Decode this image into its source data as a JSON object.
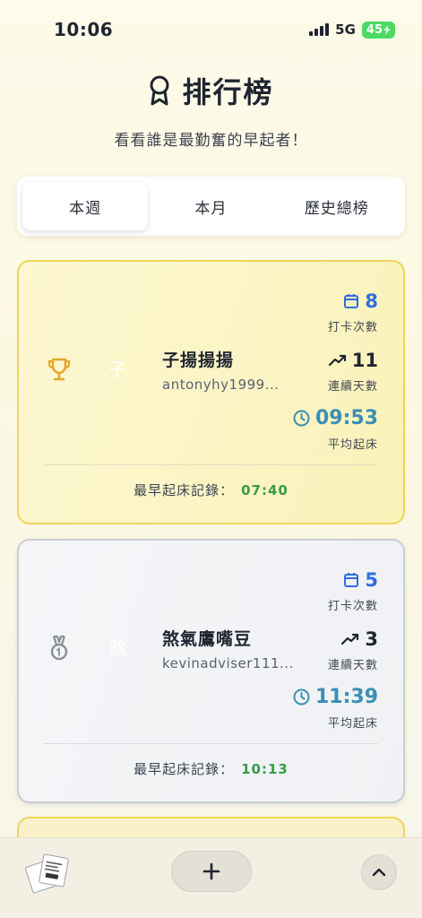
{
  "status_bar": {
    "time": "10:06",
    "network": "5G",
    "battery": "45"
  },
  "header": {
    "title": "排行榜",
    "subtitle": "看看誰是最勤奮的早起者！"
  },
  "tabs": [
    {
      "label": "本週",
      "active": true
    },
    {
      "label": "本月",
      "active": false
    },
    {
      "label": "歷史總榜",
      "active": false
    }
  ],
  "leaderboard": [
    {
      "rank_icon": "trophy-icon",
      "avatar_char": "子",
      "name": "子揚揚揚",
      "handle": "antonyhy1999...",
      "checkins": "8",
      "checkins_label": "打卡次數",
      "streak": "11",
      "streak_label": "連續天數",
      "avg_wake": "09:53",
      "avg_wake_label": "平均起床",
      "record_label": "最早起床記錄：",
      "record_time": "07:40"
    },
    {
      "rank_icon": "medal-icon",
      "avatar_char": "煞",
      "name": "煞氣鷹嘴豆",
      "handle": "kevinadviser111...",
      "checkins": "5",
      "checkins_label": "打卡次數",
      "streak": "3",
      "streak_label": "連續天數",
      "avg_wake": "11:39",
      "avg_wake_label": "平均起床",
      "record_label": "最早起床記錄：",
      "record_time": "10:13"
    }
  ],
  "colors": {
    "accent_blue": "#2f6fe0",
    "clock_teal": "#3a8fb5",
    "record_green": "#3a9a4a",
    "gold_border": "#f0d45a"
  }
}
